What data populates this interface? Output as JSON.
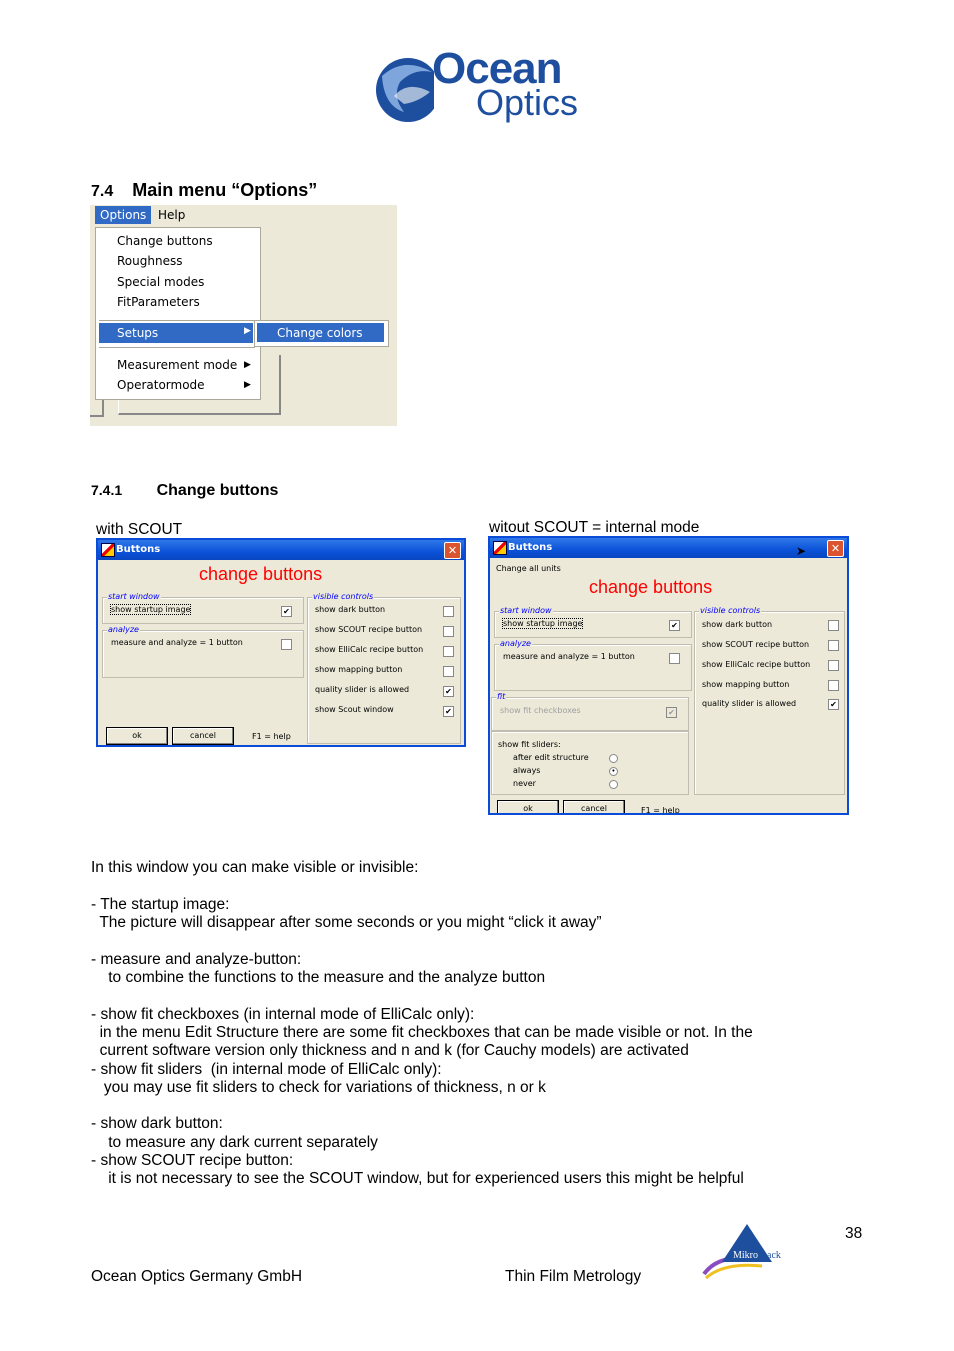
{
  "logo": {
    "line1": "Ocean",
    "line2": "Optics"
  },
  "section": {
    "number": "7.4",
    "title": "Main menu “Options”"
  },
  "menu": {
    "bar": [
      "Options",
      "Help"
    ],
    "items": [
      "Change buttons",
      "Roughness",
      "Special modes",
      "FitParameters"
    ],
    "setups": "Setups",
    "submenu": "Change colors",
    "items2": [
      "Measurement mode",
      "Operatormode"
    ],
    "highlight": "#316ac5"
  },
  "subsection": {
    "number": "7.4.1",
    "title": "Change buttons"
  },
  "caption_left": "with SCOUT",
  "caption_right": "witout SCOUT = internal mode",
  "dialog1": {
    "title": "Buttons",
    "heading": "change buttons",
    "start_window": "start window",
    "startup_image": "show startup image",
    "startup_checked": true,
    "analyze": "analyze",
    "measure_analyze": "measure and analyze = 1 button",
    "measure_checked": false,
    "visible_controls": "visible controls",
    "controls": [
      {
        "label": "show dark button",
        "checked": false
      },
      {
        "label": "show SCOUT recipe button",
        "checked": false
      },
      {
        "label": "show ElliCalc recipe button",
        "checked": false
      },
      {
        "label": "show mapping button",
        "checked": false
      },
      {
        "label": "quality slider is allowed",
        "checked": true
      },
      {
        "label": "show Scout window",
        "checked": true
      }
    ],
    "ok": "ok",
    "cancel": "cancel",
    "help": "F1 = help"
  },
  "dialog2": {
    "title": "Buttons",
    "menu": "Change all units",
    "heading": "change buttons",
    "start_window": "start window",
    "startup_image": "show startup image",
    "startup_checked": true,
    "analyze": "analyze",
    "measure_analyze": "measure and analyze = 1 button",
    "measure_checked": false,
    "fit": "fit",
    "fit_checkboxes": "show fit checkboxes",
    "fit_checked": true,
    "sliders_label": "show fit sliders:",
    "sliders": [
      {
        "label": "after edit structure",
        "selected": false
      },
      {
        "label": "always",
        "selected": true
      },
      {
        "label": "never",
        "selected": false
      }
    ],
    "visible_controls": "visible controls",
    "controls": [
      {
        "label": "show dark button",
        "checked": false
      },
      {
        "label": "show SCOUT recipe button",
        "checked": false
      },
      {
        "label": "show ElliCalc recipe button",
        "checked": false
      },
      {
        "label": "show mapping button",
        "checked": false
      },
      {
        "label": "quality slider is allowed",
        "checked": true
      }
    ],
    "ok": "ok",
    "cancel": "cancel",
    "help": "F1 = help"
  },
  "body": [
    "In this window you can make visible or invisible:",
    "- The startup image:",
    "  The picture will disappear after some seconds or you might “click it away”",
    "- measure and analyze-button:",
    "    to combine the functions to the measure and the analyze button",
    "- show fit checkboxes (in internal mode of ElliCalc only):",
    "  in the menu Edit Structure there are some fit checkboxes that can be made visible or not. In the",
    "  current software version only thickness and n and k (for Cauchy models) are activated",
    "- show fit sliders  (in internal mode of ElliCalc only):",
    "   you may use fit sliders to check for variations of thickness, n or k",
    "- show dark button:",
    "    to measure any dark current separately",
    "- show SCOUT recipe button:",
    "    it is not necessary to see the SCOUT window, but for experienced users this might be helpful"
  ],
  "footer": {
    "page": "38",
    "company": "Ocean Optics Germany GmbH",
    "subject": "Thin Film Metrology",
    "partner_logo": "Mikropack"
  }
}
